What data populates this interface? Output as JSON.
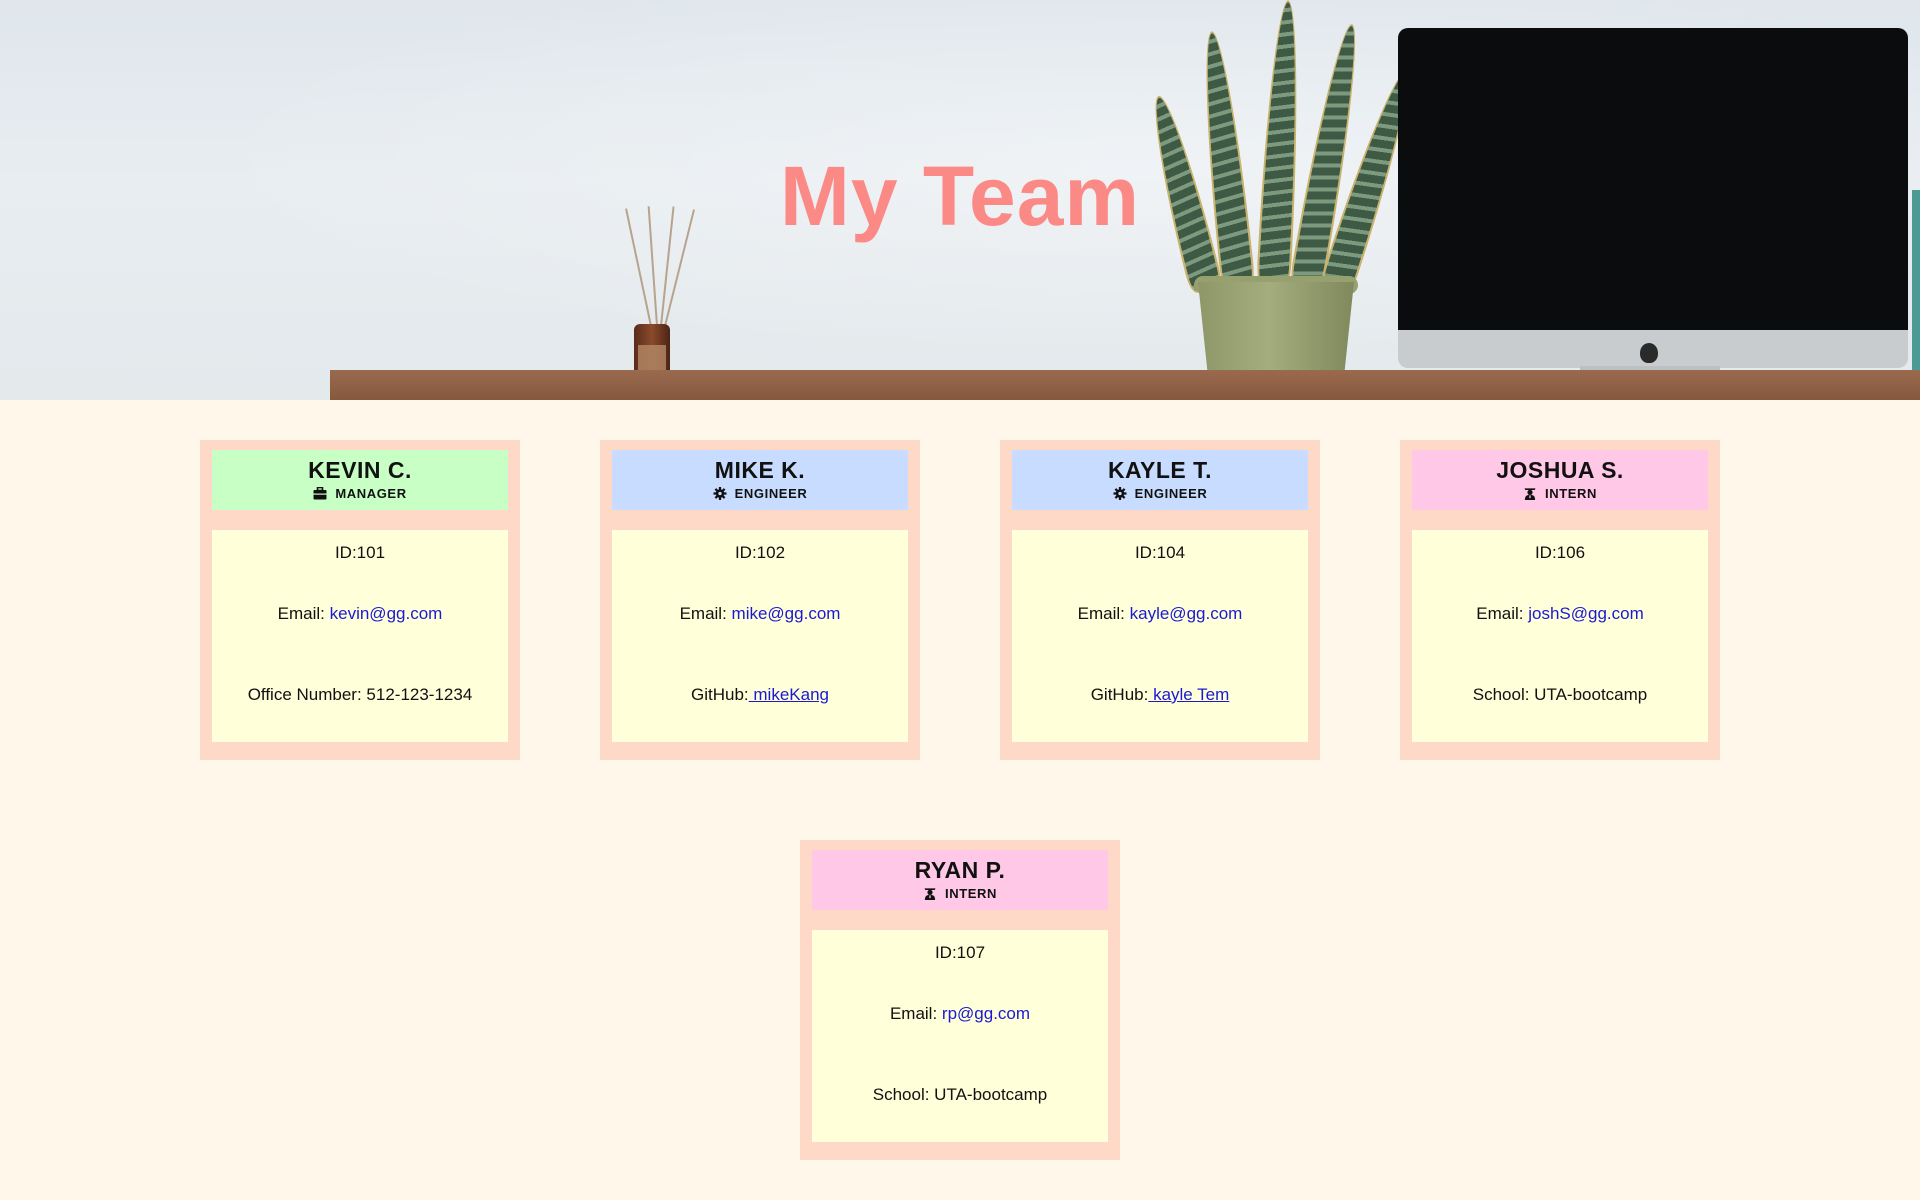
{
  "header": {
    "title": "My Team"
  },
  "employees": [
    {
      "name": "KEVIN C.",
      "role": "MANAGER",
      "role_icon": "briefcase-icon",
      "id_text": "ID:101",
      "email_label": "Email: ",
      "email": "kevin@gg.com",
      "extra_label": "Office Number: 512-123-1234",
      "extra_link": ""
    },
    {
      "name": "MIKE K.",
      "role": "ENGINEER",
      "role_icon": "gear-icon",
      "id_text": "ID:102",
      "email_label": "Email: ",
      "email": "mike@gg.com",
      "extra_label": "GitHub:",
      "extra_link": " mikeKang"
    },
    {
      "name": "KAYLE T.",
      "role": "ENGINEER",
      "role_icon": "gear-icon",
      "id_text": "ID:104",
      "email_label": "Email: ",
      "email": "kayle@gg.com",
      "extra_label": "GitHub:",
      "extra_link": " kayle Tem"
    },
    {
      "name": "JOSHUA S.",
      "role": "INTERN",
      "role_icon": "graduate-icon",
      "id_text": "ID:106",
      "email_label": "Email: ",
      "email": "joshS@gg.com",
      "extra_label": "School: UTA-bootcamp",
      "extra_link": ""
    },
    {
      "name": "RYAN P.",
      "role": "INTERN",
      "role_icon": "graduate-icon",
      "id_text": "ID:107",
      "email_label": "Email: ",
      "email": "rp@gg.com",
      "extra_label": "School: UTA-bootcamp",
      "extra_link": ""
    }
  ],
  "colors": {
    "title": "#fb8a86",
    "page_background": "#fff8ea",
    "card_border": "#ffd9c8",
    "card_body": "#ffffd9",
    "manager_header": "#c8ffc4",
    "engineer_header": "#c8dcff",
    "intern_header": "#ffc8e6",
    "link": "#1a1ad4"
  }
}
